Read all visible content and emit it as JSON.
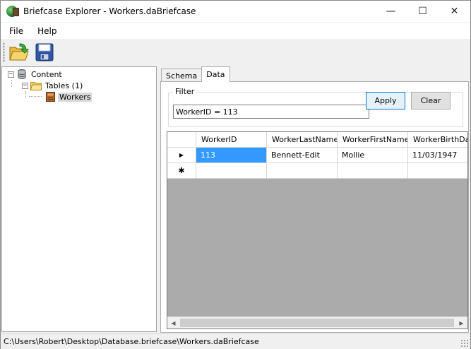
{
  "window": {
    "title": "Briefcase Explorer - Workers.daBriefcase",
    "controls": {
      "minimize": "—",
      "maximize": "☐",
      "close": "✕"
    }
  },
  "menu": {
    "file": "File",
    "help": "Help"
  },
  "toolbar": {
    "open_icon": "open-folder-icon",
    "save_icon": "save-disk-icon"
  },
  "tree": {
    "root": {
      "label": "Content",
      "expander": "−"
    },
    "tables": {
      "label": "Tables (1)",
      "expander": "−"
    },
    "workers": {
      "label": "Workers"
    }
  },
  "tabs": {
    "schema": "Schema",
    "data": "Data",
    "active": "Data"
  },
  "filter": {
    "legend": "Filter",
    "value": "WorkerID = 113",
    "apply_label": "Apply",
    "clear_label": "Clear"
  },
  "grid": {
    "columns": [
      "WorkerID",
      "WorkerLastName",
      "WorkerFirstName",
      "WorkerBirthDate"
    ],
    "rows": [
      {
        "indicator": "▶",
        "cells": [
          "113",
          "Bennett-Edit",
          "Mollie",
          "11/03/1947"
        ]
      }
    ],
    "new_row_indicator": "✱"
  },
  "status": {
    "path": "C:\\Users\\Robert\\Desktop\\Database.briefcase\\Workers.daBriefcase"
  },
  "colors": {
    "selection": "#3399ff",
    "accent_border": "#0078d7",
    "grid_empty": "#ababab"
  }
}
